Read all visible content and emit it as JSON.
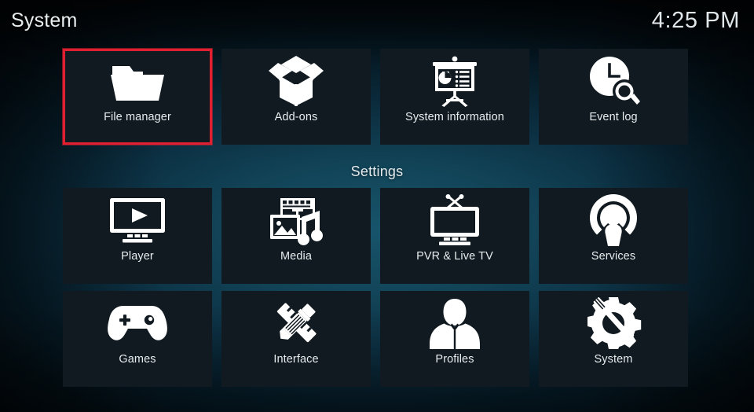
{
  "header": {
    "title": "System",
    "clock": "4:25 PM"
  },
  "colors": {
    "selection": "#e02030",
    "tile_bg": "#101a20",
    "text": "#e7edef",
    "background_center": "#17546b"
  },
  "sections": {
    "settings_heading": "Settings"
  },
  "top_row": [
    {
      "label": "File manager",
      "icon": "folder-icon",
      "selected": true
    },
    {
      "label": "Add-ons",
      "icon": "open-box-icon",
      "selected": false
    },
    {
      "label": "System information",
      "icon": "presentation-board-icon",
      "selected": false
    },
    {
      "label": "Event log",
      "icon": "clock-magnifier-icon",
      "selected": false
    }
  ],
  "settings_row_1": [
    {
      "label": "Player",
      "icon": "monitor-play-icon",
      "selected": false
    },
    {
      "label": "Media",
      "icon": "film-photo-music-icon",
      "selected": false
    },
    {
      "label": "PVR & Live TV",
      "icon": "tv-antenna-icon",
      "selected": false
    },
    {
      "label": "Services",
      "icon": "broadcast-person-icon",
      "selected": false
    }
  ],
  "settings_row_2": [
    {
      "label": "Games",
      "icon": "gamepad-icon",
      "selected": false
    },
    {
      "label": "Interface",
      "icon": "pencil-ruler-icon",
      "selected": false
    },
    {
      "label": "Profiles",
      "icon": "person-bust-icon",
      "selected": false
    },
    {
      "label": "System",
      "icon": "gear-wrench-icon",
      "selected": false
    }
  ]
}
